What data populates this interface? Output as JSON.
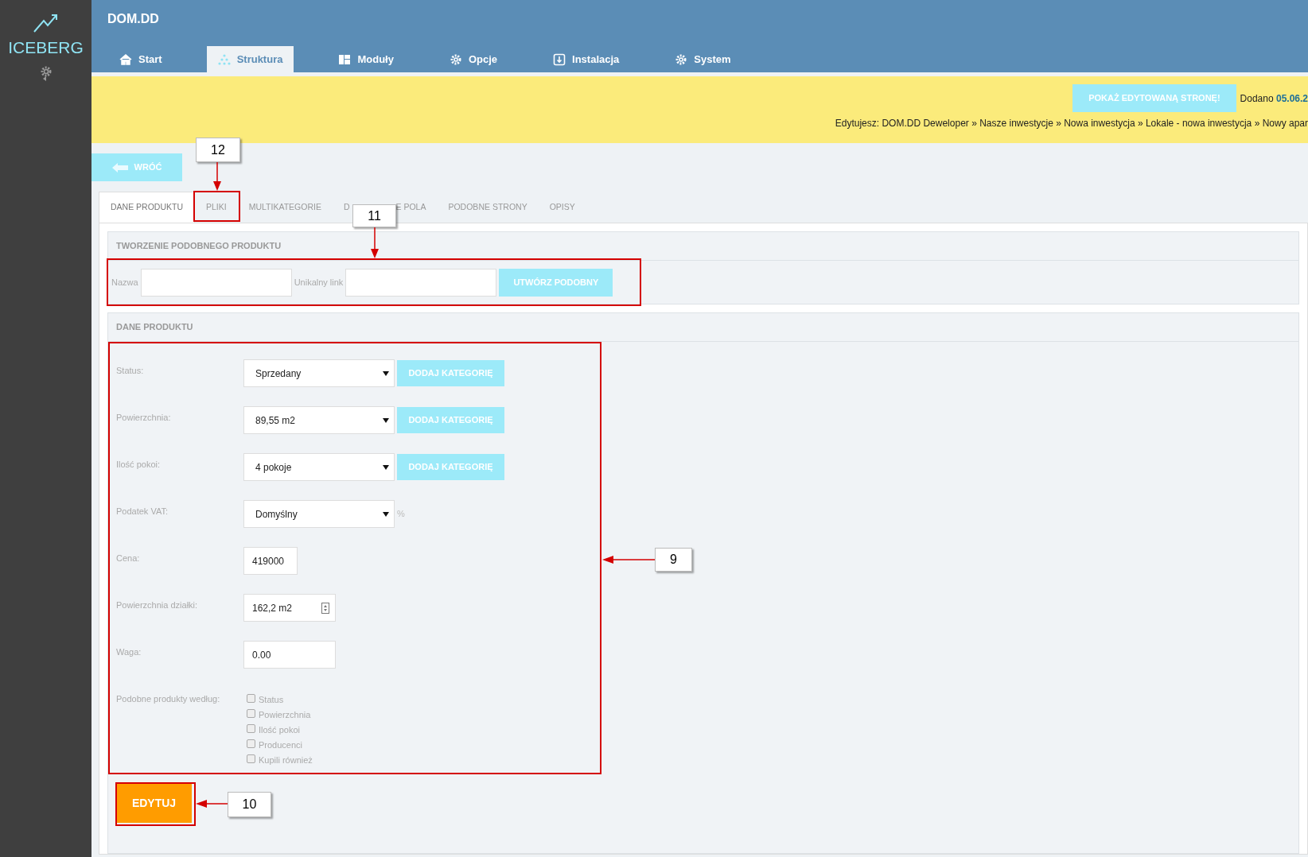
{
  "sidebar": {
    "logo": "ICEBERG"
  },
  "header": {
    "title": "DOM.DD",
    "nav": [
      {
        "label": "Start",
        "selected": false
      },
      {
        "label": "Struktura",
        "selected": true
      },
      {
        "label": "Moduły",
        "selected": false
      },
      {
        "label": "Opcje",
        "selected": false
      },
      {
        "label": "Instalacja",
        "selected": false
      },
      {
        "label": "System",
        "selected": false
      }
    ]
  },
  "notice": {
    "preview_button": "POKAŻ EDYTOWANĄ STRONĘ!",
    "added_label": "Dodano",
    "added_date": "05.06.2",
    "breadcrumb": "Edytujesz: DOM.DD Deweloper » Nasze inwestycje » Nowa inwestycja » Lokale - nowa inwestycja » Nowy apar"
  },
  "back_button": "WRÓĆ",
  "tabs": [
    {
      "label": "DANE PRODUKTU",
      "selected": true
    },
    {
      "label": "PLIKI",
      "selected": false
    },
    {
      "label": "MULTIKATEGORIE",
      "selected": false
    },
    {
      "label": "D",
      "label_after_cover": "E POLA",
      "selected": false
    },
    {
      "label": "PODOBNE STRONY",
      "selected": false
    },
    {
      "label": "OPISY",
      "selected": false
    }
  ],
  "similar_section": {
    "title": "TWORZENIE PODOBNEGO PRODUKTU",
    "name_label": "Nazwa",
    "link_label": "Unikalny link",
    "button": "UTWÓRZ PODOBNY"
  },
  "product_section": {
    "title": "DANE PRODUKTU",
    "rows": [
      {
        "kind": "select",
        "label": "Status:",
        "value": "Sprzedany",
        "button": "DODAJ KATEGORIĘ"
      },
      {
        "kind": "select",
        "label": "Powierzchnia:",
        "value": "89,55 m2",
        "button": "DODAJ KATEGORIĘ"
      },
      {
        "kind": "select",
        "label": "Ilość pokoi:",
        "value": "4 pokoje",
        "button": "DODAJ KATEGORIĘ"
      },
      {
        "kind": "select",
        "label": "Podatek VAT:",
        "value": "Domyślny",
        "unit": "%"
      },
      {
        "kind": "short_input",
        "label": "Cena:",
        "value": "419000"
      },
      {
        "kind": "number_input",
        "label": "Powierzchnia działki:",
        "value": "162,2 m2"
      },
      {
        "kind": "input",
        "label": "Waga:",
        "value": "0.00"
      },
      {
        "kind": "checkboxes",
        "label": "Podobne produkty według:",
        "options": [
          {
            "label": "Status",
            "checked": false
          },
          {
            "label": "Powierzchnia",
            "checked": false
          },
          {
            "label": "Ilość pokoi",
            "checked": false
          },
          {
            "label": "Producenci",
            "checked": false
          },
          {
            "label": "Kupili również",
            "checked": false
          }
        ]
      }
    ],
    "submit": "EDYTUJ"
  },
  "annotations": [
    {
      "kind": "callout",
      "label": "12"
    },
    {
      "kind": "callout",
      "label": "11"
    },
    {
      "kind": "callout",
      "label": "9"
    },
    {
      "kind": "callout",
      "label": "10"
    }
  ]
}
